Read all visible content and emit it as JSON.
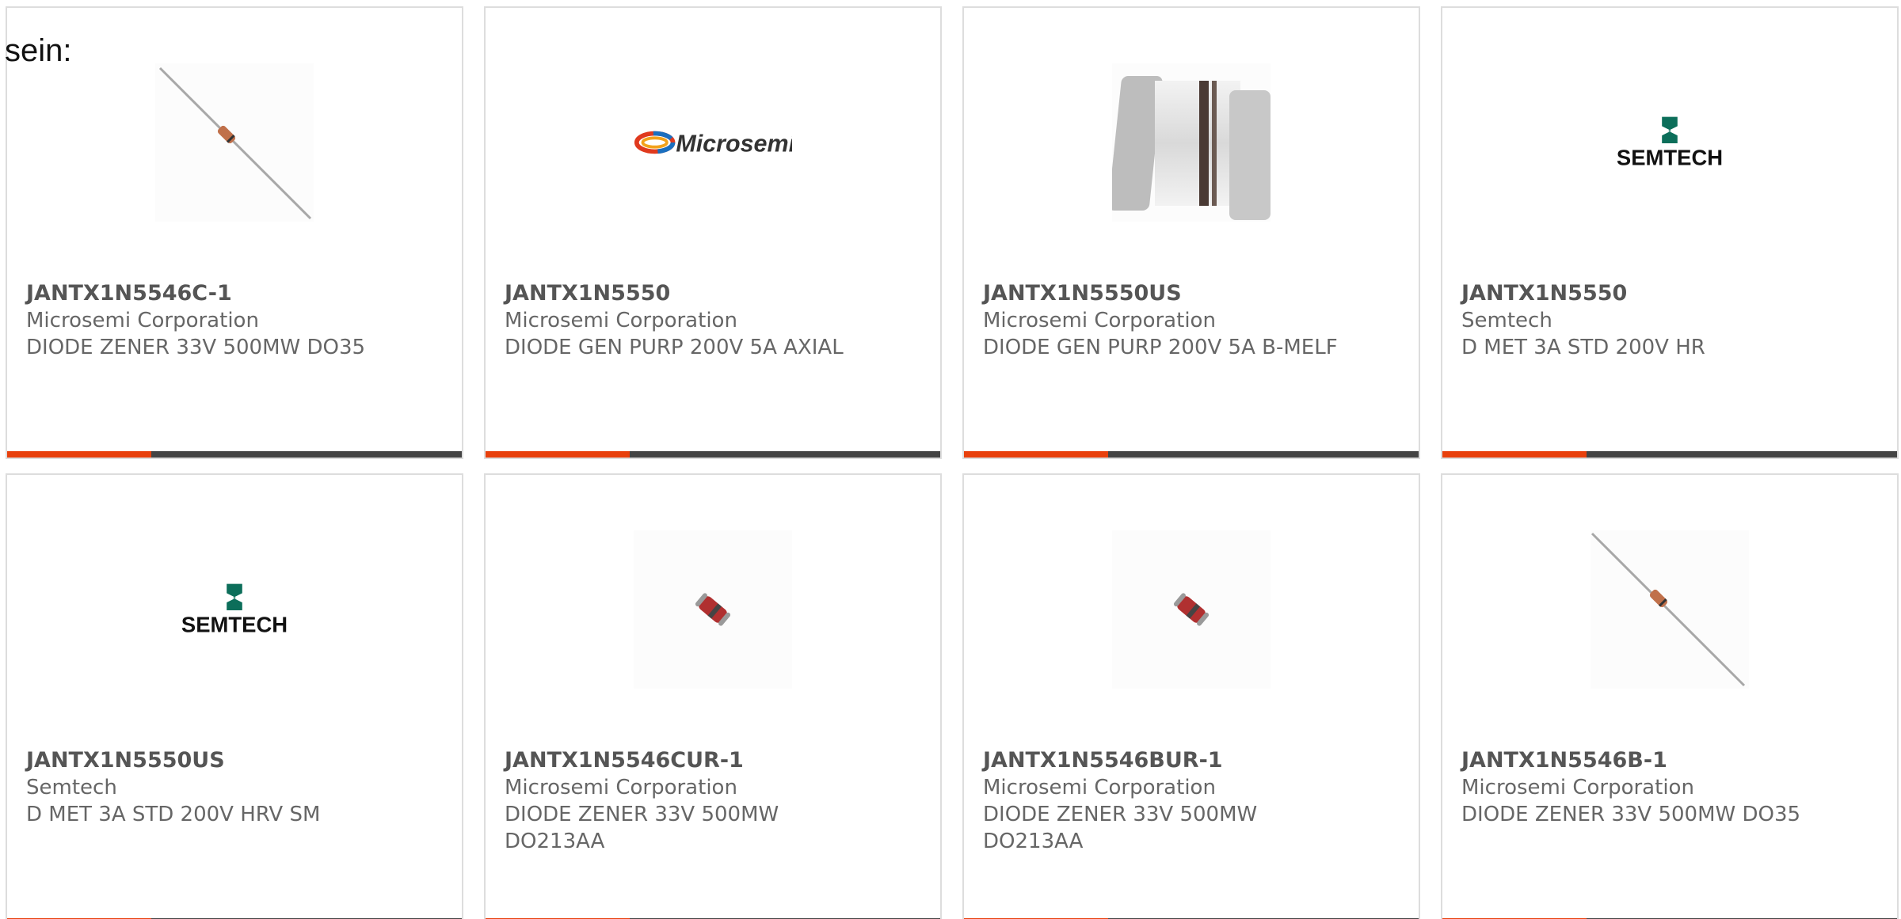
{
  "intro_text": "sein:",
  "colors": {
    "accent": "#e8400c",
    "bar": "#444444",
    "border": "#dddddd",
    "text": "#666666",
    "title": "#555555"
  },
  "products": [
    {
      "part_number": "JANTX1N5546C-1",
      "manufacturer": "Microsemi Corporation",
      "description": "DIODE ZENER 33V 500MW DO35",
      "image": "axial-diode-image"
    },
    {
      "part_number": "JANTX1N5550",
      "manufacturer": "Microsemi Corporation",
      "description": "DIODE GEN PURP 200V 5A AXIAL",
      "image": "microsemi-logo",
      "logo_text": "Microsemi"
    },
    {
      "part_number": "JANTX1N5550US",
      "manufacturer": "Microsemi Corporation",
      "description": "DIODE GEN PURP 200V 5A B-MELF",
      "image": "bmelf-diode-image"
    },
    {
      "part_number": "JANTX1N5550",
      "manufacturer": "Semtech",
      "description": "D MET 3A STD 200V HR",
      "image": "semtech-logo",
      "logo_text": "SEMTECH"
    },
    {
      "part_number": "JANTX1N5550US",
      "manufacturer": "Semtech",
      "description": "D MET 3A STD 200V HRV SM",
      "image": "semtech-logo",
      "logo_text": "SEMTECH"
    },
    {
      "part_number": "JANTX1N5546CUR-1",
      "manufacturer": "Microsemi Corporation",
      "description": "DIODE ZENER 33V 500MW DO213AA",
      "image": "melf-diode-image"
    },
    {
      "part_number": "JANTX1N5546BUR-1",
      "manufacturer": "Microsemi Corporation",
      "description": "DIODE ZENER 33V 500MW DO213AA",
      "image": "melf-diode-image"
    },
    {
      "part_number": "JANTX1N5546B-1",
      "manufacturer": "Microsemi Corporation",
      "description": "DIODE ZENER 33V 500MW DO35",
      "image": "axial-diode-image"
    }
  ]
}
